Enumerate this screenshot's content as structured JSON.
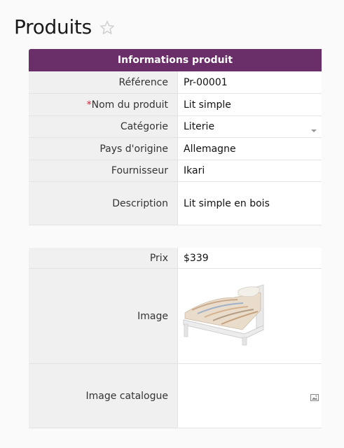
{
  "page": {
    "title": "Produits"
  },
  "section": {
    "title": "Informations produit"
  },
  "fields": {
    "reference": {
      "label": "Référence",
      "value": "Pr-00001"
    },
    "nom": {
      "required_marker": "*",
      "label": "Nom du produit",
      "value": "Lit simple"
    },
    "categorie": {
      "label": "Catégorie",
      "value": "Literie"
    },
    "pays": {
      "label": "Pays d'origine",
      "value": "Allemagne"
    },
    "fournisseur": {
      "label": "Fournisseur",
      "value": "Ikari"
    },
    "description": {
      "label": "Description",
      "value": "Lit simple en bois"
    },
    "prix": {
      "label": "Prix",
      "value": "$339"
    },
    "image": {
      "label": "Image"
    },
    "image_catalogue": {
      "label": "Image catalogue"
    }
  },
  "icons": {
    "favorite": "star-outline-icon",
    "dropdown": "chevron-down-icon",
    "image_placeholder": "image-icon",
    "product_photo": "bed-icon"
  },
  "colors": {
    "accent": "#6a2f68",
    "required": "#e0203a"
  }
}
